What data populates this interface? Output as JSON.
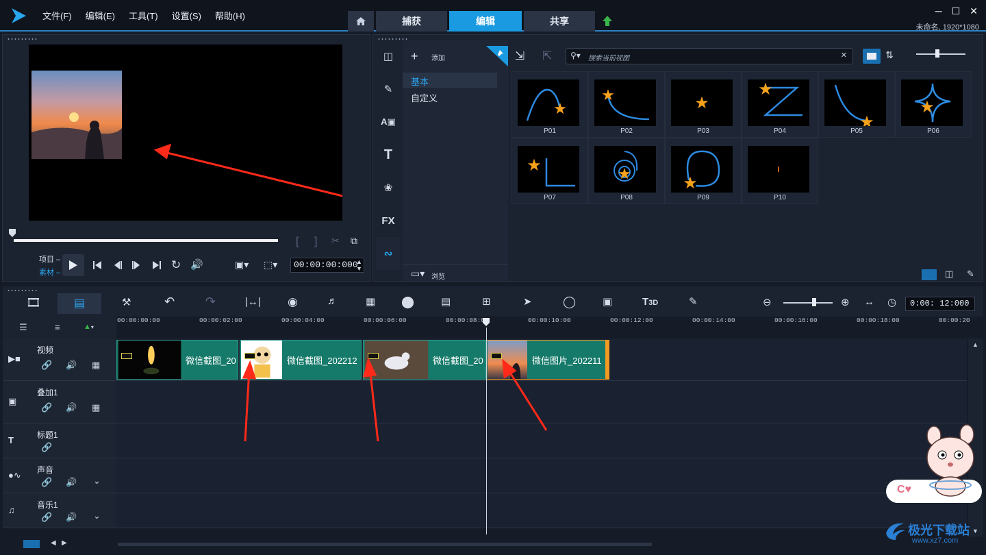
{
  "app": {
    "resolution_label": "未命名, 1920*1080"
  },
  "menu": [
    "文件(F)",
    "编辑(E)",
    "工具(T)",
    "设置(S)",
    "帮助(H)"
  ],
  "mode_tabs": [
    {
      "label": "捕获",
      "active": false
    },
    {
      "label": "编辑",
      "active": true
    },
    {
      "label": "共享",
      "active": false
    }
  ],
  "player": {
    "project_label": "项目",
    "clip_label": "素材",
    "timecode": "00:00:00:000"
  },
  "library": {
    "add_label": "添加",
    "categories": [
      {
        "label": "基本",
        "selected": true
      },
      {
        "label": "自定义",
        "selected": false
      }
    ],
    "browse_label": "浏览",
    "search_placeholder": "搜索当前视图",
    "side_icons": [
      "media-icon",
      "instant-project-icon",
      "transition-icon",
      "title-icon",
      "graphics-icon",
      "filter-icon",
      "path-icon"
    ],
    "items": [
      "P01",
      "P02",
      "P03",
      "P04",
      "P05",
      "P06",
      "P07",
      "P08",
      "P09",
      "P10"
    ]
  },
  "timeline": {
    "zoom_timecode": "0:00: 12:000",
    "ruler_ticks": [
      "00:00:00:00",
      "00:00:02:00",
      "00:00:04:00",
      "00:00:06:00",
      "00:00:08:00",
      "00:00:10:00",
      "00:00:12:00",
      "00:00:14:00",
      "00:00:16:00",
      "00:00:18:00",
      "00:00:20"
    ],
    "tracks": [
      {
        "name": "视频",
        "type": "video"
      },
      {
        "name": "叠加1",
        "type": "overlay"
      },
      {
        "name": "标题1",
        "type": "title"
      },
      {
        "name": "声音",
        "type": "voice"
      },
      {
        "name": "音乐1",
        "type": "music"
      }
    ],
    "clips": [
      {
        "name": "微信截图_20"
      },
      {
        "name": "微信截图_202212"
      },
      {
        "name": "微信截图_20"
      },
      {
        "name": "微信图片_202211"
      }
    ]
  },
  "watermark": {
    "text": "极光下载站",
    "url": "www.xz7.com"
  },
  "colors": {
    "accent": "#1a9ae0",
    "clip": "#167a6a",
    "arrow": "#ff2a1a"
  }
}
